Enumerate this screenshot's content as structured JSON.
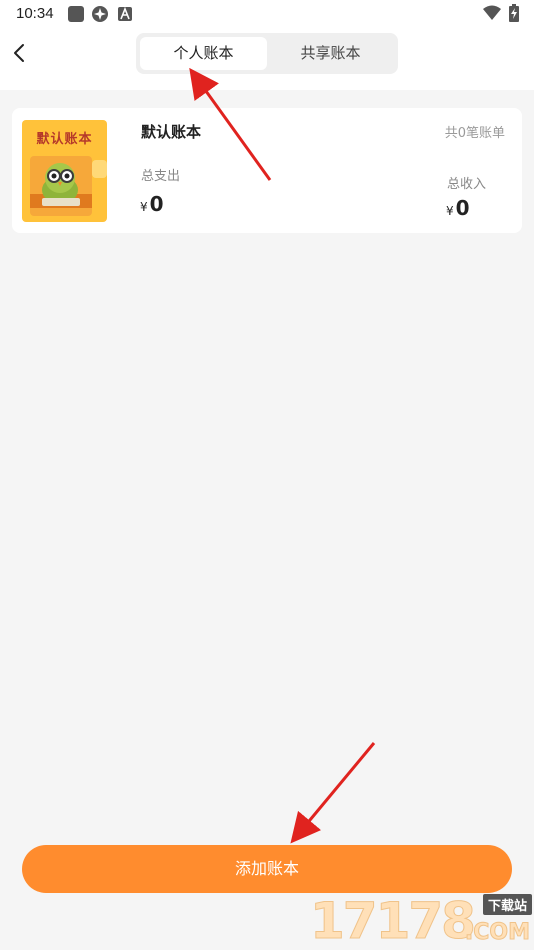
{
  "status_bar": {
    "time": "10:34",
    "icons": [
      "square-app-icon",
      "pinwheel-app-icon",
      "a-app-icon",
      "wifi-icon",
      "battery-charging-icon"
    ]
  },
  "header": {
    "back_icon": "chevron-left-icon",
    "tabs": [
      {
        "label": "个人账本",
        "active": true
      },
      {
        "label": "共享账本",
        "active": false
      }
    ]
  },
  "book_card": {
    "cover_title": "默认账本",
    "name": "默认账本",
    "bill_count": "共0笔账单",
    "expense_label": "总支出",
    "expense_currency": "¥",
    "expense_value": "0",
    "income_label": "总收入",
    "income_currency": "¥",
    "income_value": "0"
  },
  "add_button": {
    "label": "添加账本"
  },
  "watermark": {
    "digits": "17178",
    "badge": "下载站",
    "suffix": ".COM"
  },
  "colors": {
    "accent": "#ff8c2e",
    "cover": "#ffc23a",
    "annotation_arrow": "#e0231f",
    "background": "#f5f5f5"
  }
}
